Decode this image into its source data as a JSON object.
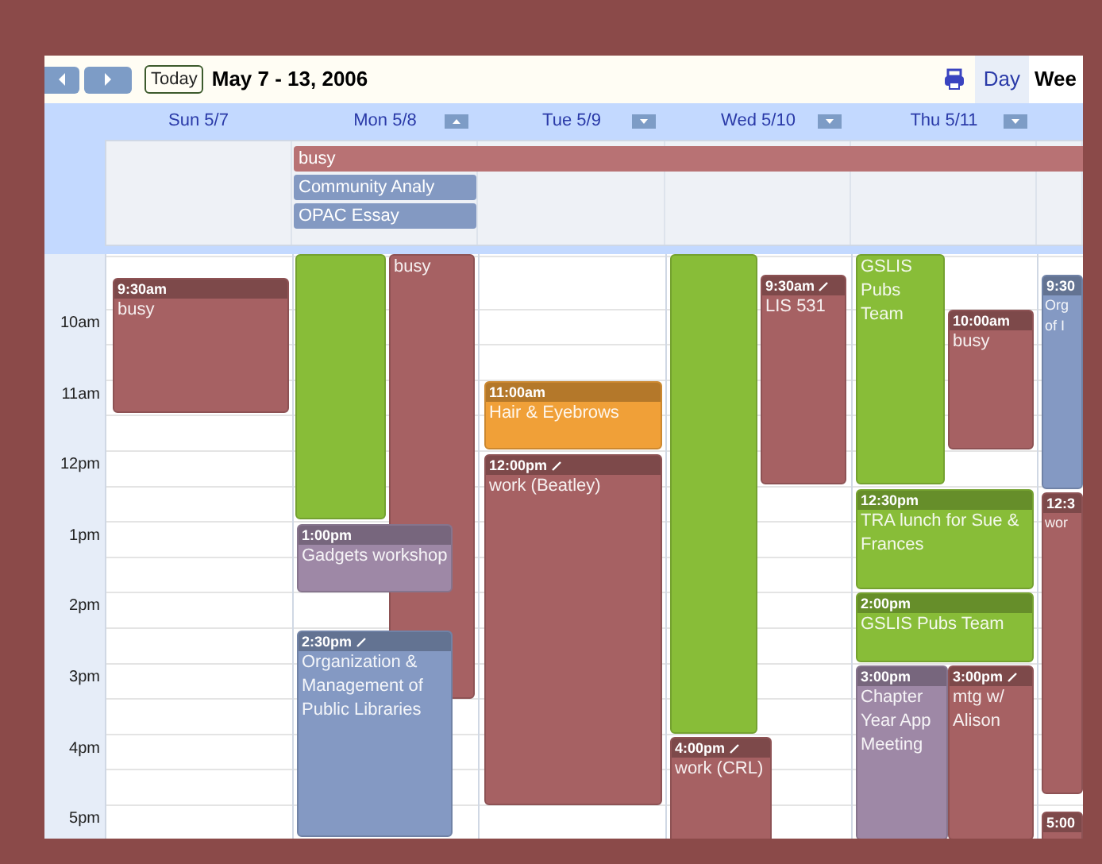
{
  "toolbar": {
    "today": "Today",
    "range": "May 7 - 13, 2006",
    "views": [
      {
        "label": "Day",
        "selected": false
      },
      {
        "label": "Wee",
        "selected": true
      }
    ]
  },
  "all_day": [
    {
      "title": "busy",
      "color": "#b87274"
    },
    {
      "title": "Community Analy",
      "color": "#8399c2"
    },
    {
      "title": "OPAC Essay",
      "color": "#8399c2"
    }
  ],
  "hours": [
    "10am",
    "11am",
    "12pm",
    "1pm",
    "2pm",
    "3pm",
    "4pm",
    "5pm"
  ],
  "columns": [
    {
      "header": "Sun 5/7",
      "events": [
        {
          "time": "9:30am",
          "title": "busy",
          "color": "#a66163",
          "pencil": false
        }
      ]
    },
    {
      "header": "Mon 5/8",
      "events": [
        {
          "color": "#88bd38",
          "pencil": false
        },
        {
          "title": "busy",
          "color": "#a66163",
          "pencil": false
        },
        {
          "time": "1:00pm",
          "title": "Gadgets workshop",
          "color": "#9e88a6",
          "pencil": false
        },
        {
          "time": "2:30pm",
          "title": "Organization & Management of Public Libraries",
          "color": "#8499c3",
          "pencil": true
        }
      ]
    },
    {
      "header": "Tue 5/9",
      "events": [
        {
          "time": "11:00am",
          "title": "Hair & Eyebrows",
          "color": "#f0a038",
          "pencil": false
        },
        {
          "time": "12:00pm",
          "title": "work (Beatley)",
          "color": "#a66163",
          "pencil": true
        }
      ]
    },
    {
      "header": "Wed 5/10",
      "events": [
        {
          "color": "#88bd38",
          "pencil": false
        },
        {
          "time": "9:30am",
          "title": "LIS 531",
          "color": "#a66163",
          "pencil": true
        },
        {
          "time": "4:00pm",
          "title": "work (CRL)",
          "color": "#a66163",
          "pencil": true
        }
      ]
    },
    {
      "header": "Thu 5/11",
      "events": [
        {
          "title": "GSLIS Pubs Team",
          "color": "#88bd38",
          "pencil": false
        },
        {
          "time": "10:00am",
          "title": "busy",
          "color": "#a66163",
          "pencil": false
        },
        {
          "time": "12:30pm",
          "title": "TRA lunch for Sue & Frances",
          "color": "#88bd38",
          "pencil": false
        },
        {
          "time": "2:00pm",
          "title": "GSLIS Pubs Team",
          "color": "#88bd38",
          "pencil": false
        },
        {
          "time": "3:00pm",
          "title": "Chapter Year App Meeting",
          "color": "#9e88a6",
          "pencil": false
        },
        {
          "time": "3:00pm",
          "title": "mtg w/ Alison",
          "color": "#a66163",
          "pencil": true
        }
      ]
    },
    {
      "events": [
        {
          "time": "9:30",
          "title": "Org of I",
          "color": "#8499c3",
          "pencil": false
        },
        {
          "time": "12:3",
          "title": "wor",
          "color": "#a66163",
          "pencil": false
        },
        {
          "time": "5:00",
          "color": "#a66163",
          "pencil": false
        }
      ]
    }
  ]
}
